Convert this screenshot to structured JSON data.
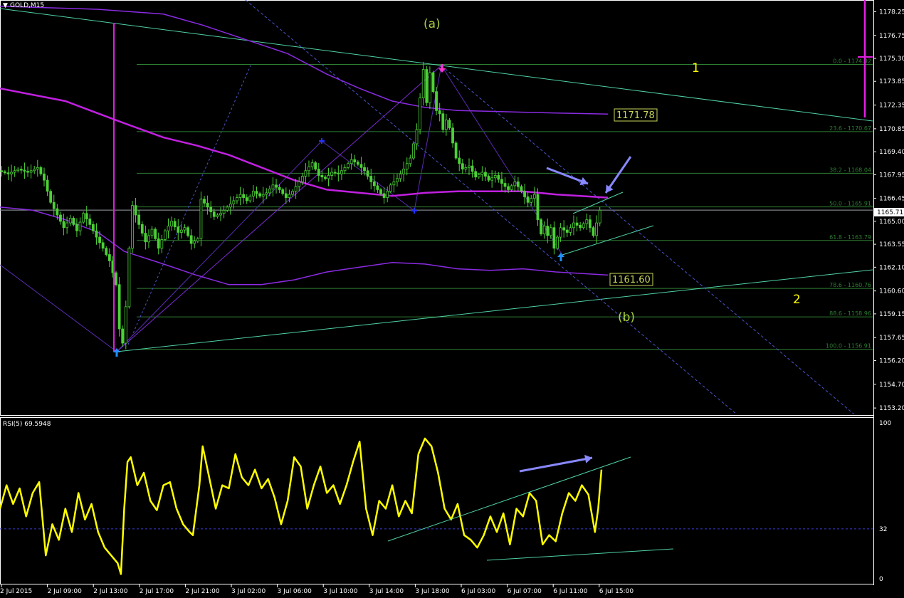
{
  "symbol_label": "GOLD,M15",
  "rsi_label": "RSI(5) 69.5948",
  "colors": {
    "background": "#000000",
    "candles": "#4cd137",
    "ma_magenta": "#c020e0",
    "ma_purple": "#8a2be2",
    "fib": "#2e7d32",
    "trendline": "#4fd1a5",
    "rsi": "#ffff00",
    "arrow": "#8888ff",
    "wave_label_yellow": "#ffff00",
    "wave_label_green": "#a8d040",
    "current_price_box": "#ffffff"
  },
  "wave_labels": {
    "a": "(a)",
    "b": "(b)",
    "one": "1",
    "two": "2"
  },
  "ma_labels": {
    "upper": "1171.78",
    "lower": "1161.60"
  },
  "current_price": "1165.71",
  "chart_data": {
    "type": "line",
    "title": "",
    "price_axis": {
      "ticks": [
        "1178.25",
        "1176.75",
        "1175.30",
        "1173.85",
        "1172.35",
        "1170.85",
        "1169.40",
        "1167.95",
        "1166.45",
        "1165.00",
        "1163.55",
        "1162.10",
        "1160.60",
        "1159.15",
        "1157.65",
        "1156.20",
        "1154.70",
        "1153.20"
      ],
      "ylim": [
        1152.8,
        1178.9
      ]
    },
    "time_axis": {
      "ticks": [
        "2 Jul 2015",
        "2 Jul 09:00",
        "2 Jul 13:00",
        "2 Jul 17:00",
        "2 Jul 21:00",
        "3 Jul 02:00",
        "3 Jul 06:00",
        "3 Jul 10:00",
        "3 Jul 14:00",
        "3 Jul 18:00",
        "6 Jul 03:00",
        "6 Jul 07:00",
        "6 Jul 11:00",
        "6 Jul 15:00"
      ]
    },
    "fibonacci_levels": [
      {
        "label": "0.0 - 1174.92",
        "value": 1174.92
      },
      {
        "label": "23.6 - 1170.67",
        "value": 1170.67
      },
      {
        "label": "38.2 - 1168.04",
        "value": 1168.04
      },
      {
        "label": "50.0 - 1165.91",
        "value": 1165.91
      },
      {
        "label": "61.8 - 1163.79",
        "value": 1163.79
      },
      {
        "label": "78.6 - 1160.76",
        "value": 1160.76
      },
      {
        "label": "88.6 - 1158.96",
        "value": 1158.96
      },
      {
        "label": "100.0 - 1156.91",
        "value": 1156.91
      }
    ],
    "price_series": [
      {
        "x": 0,
        "y": 1168.2
      },
      {
        "x": 3,
        "y": 1168.0
      },
      {
        "x": 6,
        "y": 1168.3
      },
      {
        "x": 9,
        "y": 1168.1
      },
      {
        "x": 12,
        "y": 1168.4
      },
      {
        "x": 14,
        "y": 1167.6
      },
      {
        "x": 16,
        "y": 1166.2
      },
      {
        "x": 18,
        "y": 1165.4
      },
      {
        "x": 20,
        "y": 1164.6
      },
      {
        "x": 22,
        "y": 1165.2
      },
      {
        "x": 24,
        "y": 1164.4
      },
      {
        "x": 26,
        "y": 1165.5
      },
      {
        "x": 28,
        "y": 1164.8
      },
      {
        "x": 30,
        "y": 1164.0
      },
      {
        "x": 32,
        "y": 1163.3
      },
      {
        "x": 34,
        "y": 1162.5
      },
      {
        "x": 36,
        "y": 1161.0
      },
      {
        "x": 37,
        "y": 1158.2
      },
      {
        "x": 38,
        "y": 1157.3
      },
      {
        "x": 39,
        "y": 1159.6
      },
      {
        "x": 40,
        "y": 1163.3
      },
      {
        "x": 41,
        "y": 1166.0
      },
      {
        "x": 43,
        "y": 1164.8
      },
      {
        "x": 45,
        "y": 1163.7
      },
      {
        "x": 47,
        "y": 1164.5
      },
      {
        "x": 49,
        "y": 1163.3
      },
      {
        "x": 51,
        "y": 1164.4
      },
      {
        "x": 53,
        "y": 1165.0
      },
      {
        "x": 55,
        "y": 1164.3
      },
      {
        "x": 57,
        "y": 1164.6
      },
      {
        "x": 59,
        "y": 1163.6
      },
      {
        "x": 61,
        "y": 1163.9
      },
      {
        "x": 62,
        "y": 1166.4
      },
      {
        "x": 64,
        "y": 1165.9
      },
      {
        "x": 66,
        "y": 1165.3
      },
      {
        "x": 68,
        "y": 1165.5
      },
      {
        "x": 70,
        "y": 1165.9
      },
      {
        "x": 72,
        "y": 1166.3
      },
      {
        "x": 74,
        "y": 1166.7
      },
      {
        "x": 76,
        "y": 1166.3
      },
      {
        "x": 78,
        "y": 1166.9
      },
      {
        "x": 80,
        "y": 1166.6
      },
      {
        "x": 82,
        "y": 1166.8
      },
      {
        "x": 84,
        "y": 1167.3
      },
      {
        "x": 86,
        "y": 1167.0
      },
      {
        "x": 88,
        "y": 1166.5
      },
      {
        "x": 90,
        "y": 1166.9
      },
      {
        "x": 92,
        "y": 1167.5
      },
      {
        "x": 94,
        "y": 1168.2
      },
      {
        "x": 96,
        "y": 1168.7
      },
      {
        "x": 98,
        "y": 1167.9
      },
      {
        "x": 100,
        "y": 1167.7
      },
      {
        "x": 102,
        "y": 1168.1
      },
      {
        "x": 104,
        "y": 1168.0
      },
      {
        "x": 106,
        "y": 1168.4
      },
      {
        "x": 108,
        "y": 1168.9
      },
      {
        "x": 110,
        "y": 1168.6
      },
      {
        "x": 112,
        "y": 1168.2
      },
      {
        "x": 114,
        "y": 1167.5
      },
      {
        "x": 116,
        "y": 1167.0
      },
      {
        "x": 118,
        "y": 1166.5
      },
      {
        "x": 120,
        "y": 1167.3
      },
      {
        "x": 122,
        "y": 1167.7
      },
      {
        "x": 124,
        "y": 1168.3
      },
      {
        "x": 126,
        "y": 1169.0
      },
      {
        "x": 128,
        "y": 1170.8
      },
      {
        "x": 129,
        "y": 1172.8
      },
      {
        "x": 130,
        "y": 1174.6
      },
      {
        "x": 131,
        "y": 1172.5
      },
      {
        "x": 132,
        "y": 1174.4
      },
      {
        "x": 133,
        "y": 1173.2
      },
      {
        "x": 134,
        "y": 1172.0
      },
      {
        "x": 135,
        "y": 1171.8
      },
      {
        "x": 136,
        "y": 1170.8
      },
      {
        "x": 137,
        "y": 1171.4
      },
      {
        "x": 138,
        "y": 1170.9
      },
      {
        "x": 140,
        "y": 1169.0
      },
      {
        "x": 142,
        "y": 1168.3
      },
      {
        "x": 144,
        "y": 1168.5
      },
      {
        "x": 146,
        "y": 1167.8
      },
      {
        "x": 148,
        "y": 1168.1
      },
      {
        "x": 150,
        "y": 1167.6
      },
      {
        "x": 152,
        "y": 1167.9
      },
      {
        "x": 154,
        "y": 1167.4
      },
      {
        "x": 156,
        "y": 1167.0
      },
      {
        "x": 158,
        "y": 1167.5
      },
      {
        "x": 160,
        "y": 1166.9
      },
      {
        "x": 162,
        "y": 1166.2
      },
      {
        "x": 164,
        "y": 1166.7
      },
      {
        "x": 165,
        "y": 1165.1
      },
      {
        "x": 166,
        "y": 1164.2
      },
      {
        "x": 167,
        "y": 1164.7
      },
      {
        "x": 168,
        "y": 1164.1
      },
      {
        "x": 169,
        "y": 1164.6
      },
      {
        "x": 170,
        "y": 1163.3
      },
      {
        "x": 171,
        "y": 1164.0
      },
      {
        "x": 172,
        "y": 1164.6
      },
      {
        "x": 174,
        "y": 1164.3
      },
      {
        "x": 176,
        "y": 1164.9
      },
      {
        "x": 178,
        "y": 1164.6
      },
      {
        "x": 180,
        "y": 1165.1
      },
      {
        "x": 182,
        "y": 1164.1
      },
      {
        "x": 183,
        "y": 1164.9
      },
      {
        "x": 184,
        "y": 1165.7
      }
    ],
    "ma_upper_series": [
      {
        "x": 0,
        "y": 1173.4
      },
      {
        "x": 20,
        "y": 1172.6
      },
      {
        "x": 38,
        "y": 1171.2
      },
      {
        "x": 50,
        "y": 1170.3
      },
      {
        "x": 60,
        "y": 1169.8
      },
      {
        "x": 70,
        "y": 1169.2
      },
      {
        "x": 80,
        "y": 1168.4
      },
      {
        "x": 90,
        "y": 1167.6
      },
      {
        "x": 100,
        "y": 1167.0
      },
      {
        "x": 110,
        "y": 1166.8
      },
      {
        "x": 120,
        "y": 1166.6
      },
      {
        "x": 130,
        "y": 1166.8
      },
      {
        "x": 140,
        "y": 1166.9
      },
      {
        "x": 150,
        "y": 1166.9
      },
      {
        "x": 160,
        "y": 1166.9
      },
      {
        "x": 170,
        "y": 1166.7
      },
      {
        "x": 186,
        "y": 1166.5
      }
    ],
    "ma_long_top_series": [
      {
        "x": 0,
        "y": 1178.6
      },
      {
        "x": 30,
        "y": 1178.4
      },
      {
        "x": 50,
        "y": 1178.1
      },
      {
        "x": 62,
        "y": 1177.4
      },
      {
        "x": 75,
        "y": 1176.5
      },
      {
        "x": 88,
        "y": 1175.6
      },
      {
        "x": 100,
        "y": 1174.3
      },
      {
        "x": 110,
        "y": 1173.4
      },
      {
        "x": 120,
        "y": 1172.6
      },
      {
        "x": 130,
        "y": 1172.2
      },
      {
        "x": 140,
        "y": 1172.0
      },
      {
        "x": 150,
        "y": 1171.95
      },
      {
        "x": 160,
        "y": 1171.9
      },
      {
        "x": 170,
        "y": 1171.85
      },
      {
        "x": 186,
        "y": 1171.78
      }
    ],
    "ma_lower_series": [
      {
        "x": 0,
        "y": 1165.9
      },
      {
        "x": 10,
        "y": 1165.7
      },
      {
        "x": 20,
        "y": 1165.1
      },
      {
        "x": 30,
        "y": 1164.3
      },
      {
        "x": 38,
        "y": 1163.1
      },
      {
        "x": 50,
        "y": 1162.3
      },
      {
        "x": 60,
        "y": 1161.6
      },
      {
        "x": 70,
        "y": 1161.0
      },
      {
        "x": 80,
        "y": 1161.0
      },
      {
        "x": 90,
        "y": 1161.3
      },
      {
        "x": 100,
        "y": 1161.8
      },
      {
        "x": 110,
        "y": 1162.1
      },
      {
        "x": 120,
        "y": 1162.4
      },
      {
        "x": 130,
        "y": 1162.3
      },
      {
        "x": 140,
        "y": 1162.0
      },
      {
        "x": 150,
        "y": 1161.9
      },
      {
        "x": 160,
        "y": 1162.0
      },
      {
        "x": 170,
        "y": 1161.8
      },
      {
        "x": 186,
        "y": 1161.6
      }
    ],
    "rsi_axis": {
      "ticks": [
        "100",
        "32",
        "0"
      ],
      "ylim": [
        0,
        100
      ],
      "level": 32
    },
    "rsi_series": [
      {
        "x": 0,
        "y": 45
      },
      {
        "x": 2,
        "y": 60
      },
      {
        "x": 4,
        "y": 48
      },
      {
        "x": 6,
        "y": 58
      },
      {
        "x": 8,
        "y": 40
      },
      {
        "x": 10,
        "y": 55
      },
      {
        "x": 12,
        "y": 62
      },
      {
        "x": 14,
        "y": 15
      },
      {
        "x": 16,
        "y": 35
      },
      {
        "x": 18,
        "y": 25
      },
      {
        "x": 20,
        "y": 45
      },
      {
        "x": 22,
        "y": 30
      },
      {
        "x": 24,
        "y": 55
      },
      {
        "x": 26,
        "y": 38
      },
      {
        "x": 28,
        "y": 48
      },
      {
        "x": 30,
        "y": 30
      },
      {
        "x": 32,
        "y": 20
      },
      {
        "x": 34,
        "y": 15
      },
      {
        "x": 36,
        "y": 10
      },
      {
        "x": 37,
        "y": 3
      },
      {
        "x": 38,
        "y": 45
      },
      {
        "x": 39,
        "y": 75
      },
      {
        "x": 40,
        "y": 78
      },
      {
        "x": 42,
        "y": 60
      },
      {
        "x": 44,
        "y": 68
      },
      {
        "x": 46,
        "y": 50
      },
      {
        "x": 48,
        "y": 44
      },
      {
        "x": 50,
        "y": 60
      },
      {
        "x": 52,
        "y": 62
      },
      {
        "x": 54,
        "y": 45
      },
      {
        "x": 56,
        "y": 35
      },
      {
        "x": 58,
        "y": 30
      },
      {
        "x": 59,
        "y": 28
      },
      {
        "x": 61,
        "y": 60
      },
      {
        "x": 62,
        "y": 85
      },
      {
        "x": 64,
        "y": 65
      },
      {
        "x": 66,
        "y": 45
      },
      {
        "x": 68,
        "y": 60
      },
      {
        "x": 70,
        "y": 58
      },
      {
        "x": 72,
        "y": 80
      },
      {
        "x": 74,
        "y": 65
      },
      {
        "x": 76,
        "y": 60
      },
      {
        "x": 78,
        "y": 70
      },
      {
        "x": 80,
        "y": 58
      },
      {
        "x": 82,
        "y": 64
      },
      {
        "x": 84,
        "y": 52
      },
      {
        "x": 86,
        "y": 35
      },
      {
        "x": 88,
        "y": 50
      },
      {
        "x": 90,
        "y": 78
      },
      {
        "x": 92,
        "y": 72
      },
      {
        "x": 94,
        "y": 45
      },
      {
        "x": 96,
        "y": 60
      },
      {
        "x": 98,
        "y": 72
      },
      {
        "x": 100,
        "y": 55
      },
      {
        "x": 102,
        "y": 60
      },
      {
        "x": 104,
        "y": 48
      },
      {
        "x": 106,
        "y": 60
      },
      {
        "x": 108,
        "y": 75
      },
      {
        "x": 110,
        "y": 88
      },
      {
        "x": 112,
        "y": 45
      },
      {
        "x": 114,
        "y": 28
      },
      {
        "x": 116,
        "y": 50
      },
      {
        "x": 118,
        "y": 45
      },
      {
        "x": 120,
        "y": 60
      },
      {
        "x": 122,
        "y": 40
      },
      {
        "x": 124,
        "y": 50
      },
      {
        "x": 126,
        "y": 42
      },
      {
        "x": 128,
        "y": 80
      },
      {
        "x": 130,
        "y": 90
      },
      {
        "x": 132,
        "y": 85
      },
      {
        "x": 134,
        "y": 68
      },
      {
        "x": 136,
        "y": 45
      },
      {
        "x": 138,
        "y": 38
      },
      {
        "x": 140,
        "y": 48
      },
      {
        "x": 142,
        "y": 28
      },
      {
        "x": 144,
        "y": 25
      },
      {
        "x": 146,
        "y": 20
      },
      {
        "x": 148,
        "y": 28
      },
      {
        "x": 150,
        "y": 40
      },
      {
        "x": 152,
        "y": 30
      },
      {
        "x": 154,
        "y": 42
      },
      {
        "x": 156,
        "y": 22
      },
      {
        "x": 158,
        "y": 45
      },
      {
        "x": 160,
        "y": 40
      },
      {
        "x": 162,
        "y": 55
      },
      {
        "x": 164,
        "y": 50
      },
      {
        "x": 166,
        "y": 22
      },
      {
        "x": 168,
        "y": 28
      },
      {
        "x": 170,
        "y": 24
      },
      {
        "x": 172,
        "y": 42
      },
      {
        "x": 174,
        "y": 55
      },
      {
        "x": 176,
        "y": 50
      },
      {
        "x": 178,
        "y": 60
      },
      {
        "x": 180,
        "y": 54
      },
      {
        "x": 182,
        "y": 30
      },
      {
        "x": 183,
        "y": 45
      },
      {
        "x": 184,
        "y": 70
      }
    ]
  }
}
